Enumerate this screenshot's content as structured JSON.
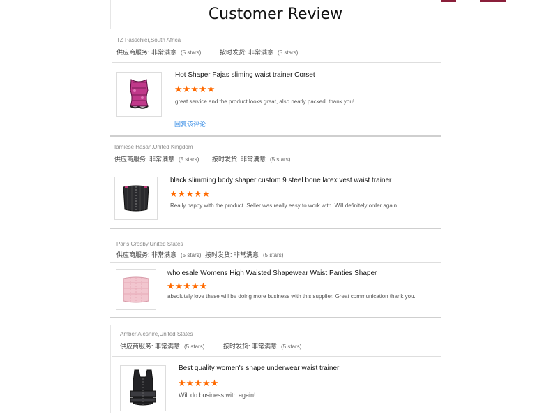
{
  "page_title": "Customer Review",
  "colors": {
    "star": "#ff6a00",
    "link": "#3a8ee6",
    "accent": "#8a1f3a"
  },
  "labels": {
    "supplier_service": "供应商服务: 非常满意",
    "on_time_delivery": "按时发货: 非常满意",
    "stars_text": "(5 stars)"
  },
  "reviews": [
    {
      "reviewer": "TZ Passchier,South Africa",
      "product": "Hot Shaper Fajas sliming waist trainer Corset",
      "rating": 5,
      "stars": "★★★★★",
      "comment": "great service and the product looks great, also neatly packed. thank you!",
      "reply_link": "回复该评论",
      "thumb_icon": "pink-corset-icon"
    },
    {
      "reviewer": "Iamiese Hasan,United Kingdom",
      "product": "black slimming body shaper custom 9 steel bone latex vest waist trainer",
      "rating": 5,
      "stars": "★★★★★",
      "comment": "Really happy with the product. Seller was really easy to work with. Will definitely order again",
      "thumb_icon": "black-waist-trainer-icon"
    },
    {
      "reviewer": "Paris Crosby,United States",
      "product": "wholesale Womens High Waisted Shapewear Waist Panties Shaper",
      "rating": 5,
      "stars": "★★★★★",
      "comment": "absolutely love these will be doing more business with this supplier. Great communication thank you.",
      "thumb_icon": "pink-shaper-icon"
    },
    {
      "reviewer": "Amber Aleshire,United States",
      "product": "Best quality women's shape underwear waist trainer",
      "rating": 5,
      "stars": "★★★★★",
      "comment": "Will do business with again!",
      "thumb_icon": "black-vest-trainer-icon"
    }
  ]
}
